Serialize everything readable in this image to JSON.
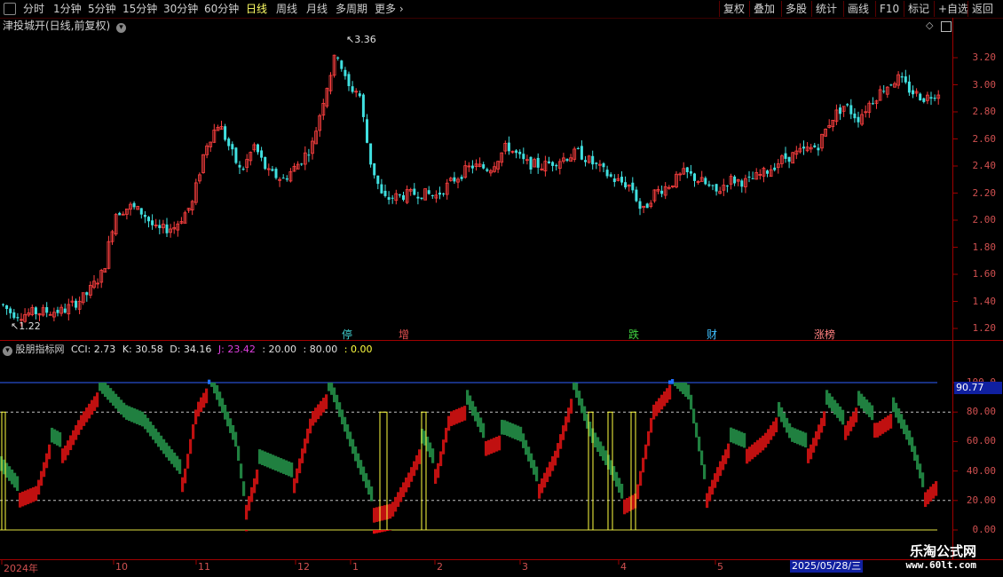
{
  "toolbar": {
    "periods": [
      "分时",
      "1分钟",
      "5分钟",
      "15分钟",
      "30分钟",
      "60分钟",
      "日线",
      "周线",
      "月线",
      "多周期",
      "更多"
    ],
    "active": "日线",
    "right_buttons": [
      "复权",
      "叠加",
      "多股",
      "统计",
      "画线",
      "F10",
      "标记",
      "+自选",
      "返回"
    ]
  },
  "stock_title": "津投城开(日线,前复权)",
  "price_axis": [
    "3.20",
    "3.00",
    "2.80",
    "2.60",
    "2.40",
    "2.20",
    "2.00",
    "1.80",
    "1.60",
    "1.40",
    "1.20"
  ],
  "high_label": "3.36",
  "low_label": "1.22",
  "events": [
    {
      "label": "停",
      "color": "#40d0d0"
    },
    {
      "label": "增",
      "color": "#e05050"
    },
    {
      "label": "跌",
      "color": "#40d040"
    },
    {
      "label": "财",
      "color": "#40c0ff"
    },
    {
      "label": "涨榜",
      "color": "#ff8080"
    }
  ],
  "indicator": {
    "name": "股朋指标网",
    "cci_label": "CCI: 2.73",
    "k_label": "K: 30.58",
    "d_label": "D: 34.16",
    "j_label": "J: 23.42",
    "l20": ": 20.00",
    "l80": ": 80.00",
    "l0": ": 0.00"
  },
  "ind_axis": [
    "100.0",
    "80.00",
    "60.00",
    "40.00",
    "20.00",
    "0.00"
  ],
  "ind_current": "90.77",
  "dates": [
    "2024年",
    "10",
    "11",
    "12",
    "1",
    "2",
    "3",
    "4",
    "5"
  ],
  "current_date": "2025/05/28/三",
  "watermark": {
    "name": "乐淘公式网",
    "url": "www.60lt.com"
  },
  "colors": {
    "up": "#ff4040",
    "down": "#40e0e0",
    "axis": "#d05050"
  }
}
